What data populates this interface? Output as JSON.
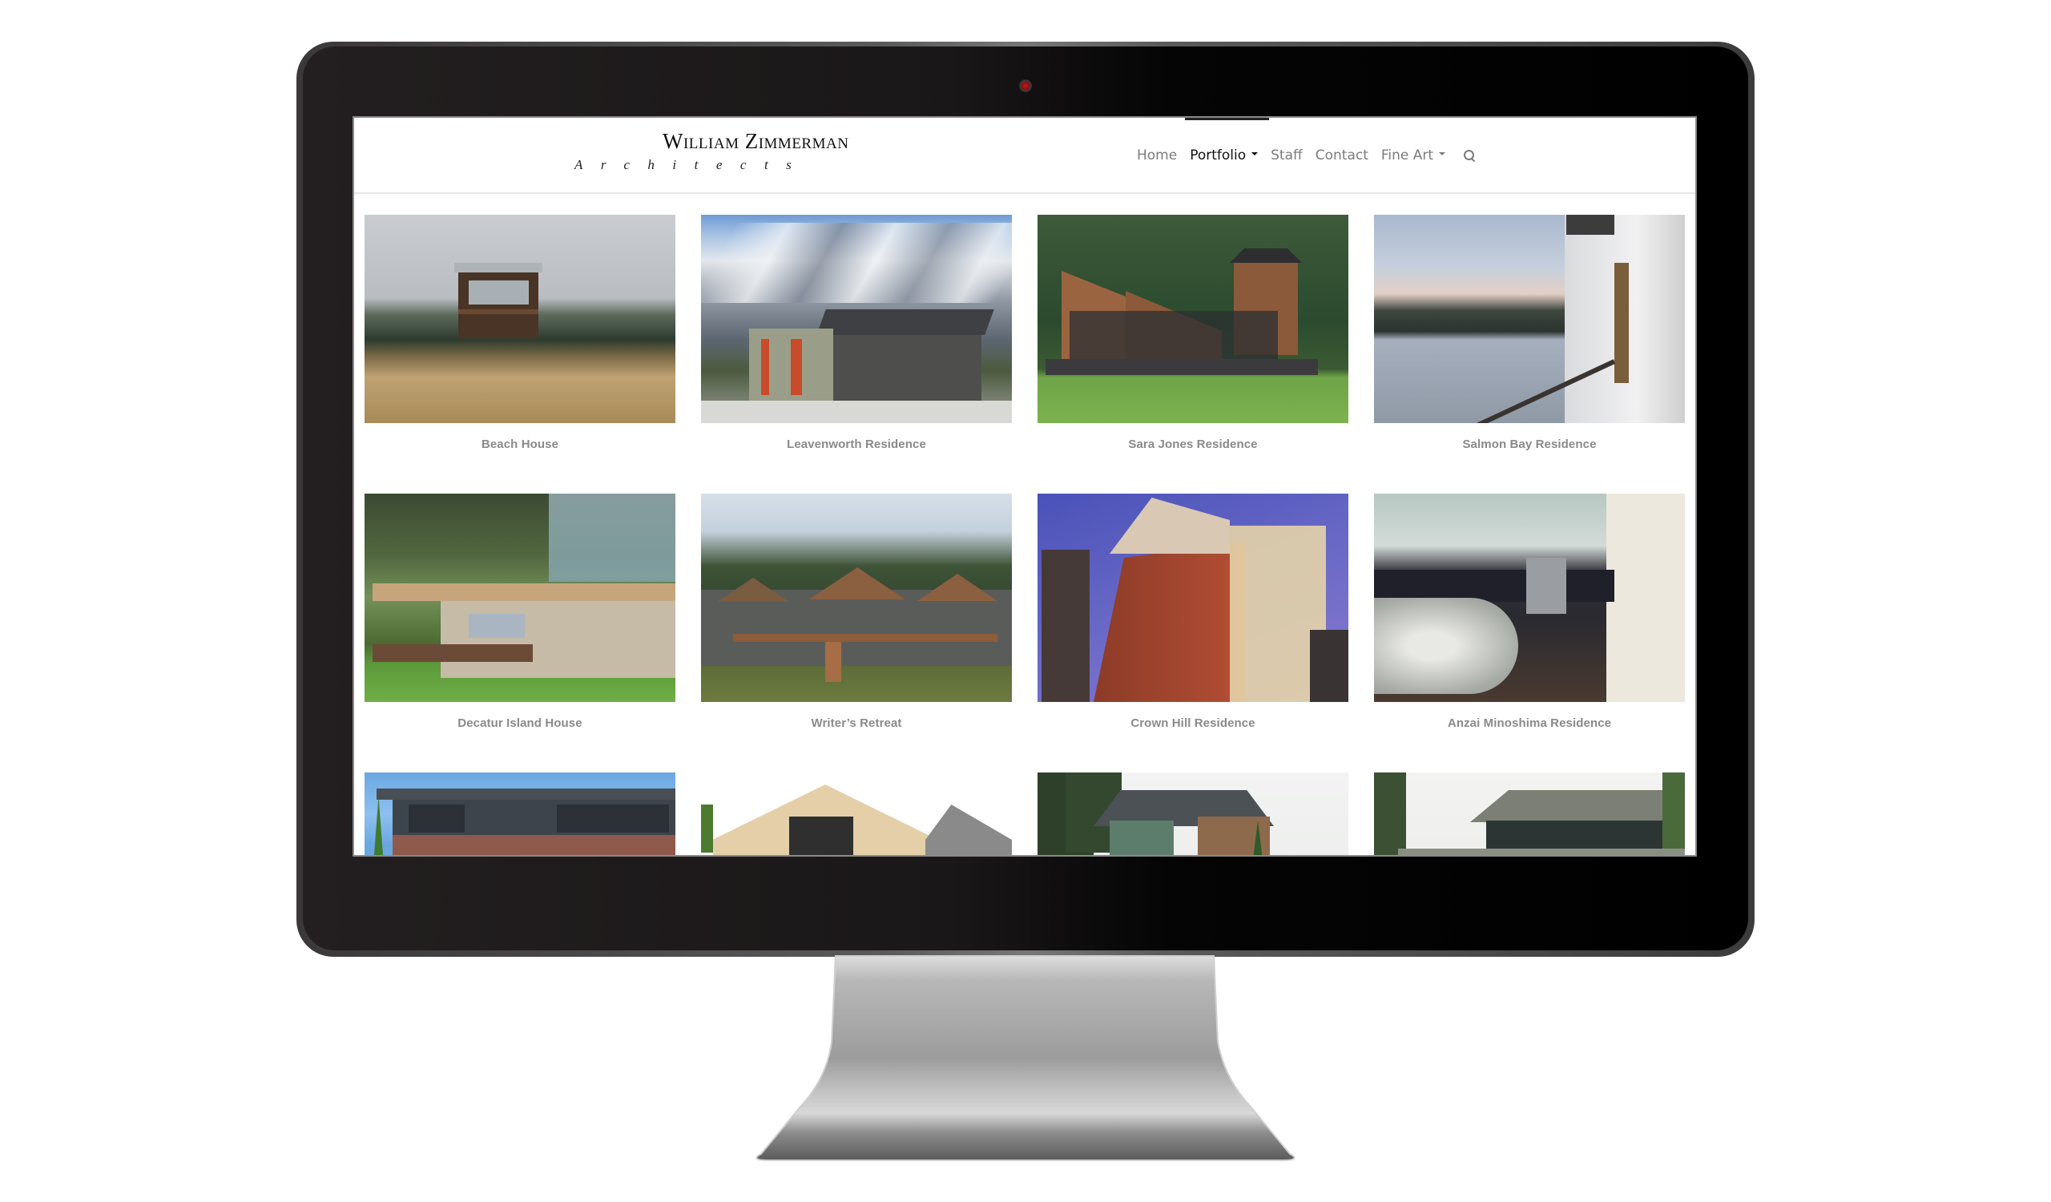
{
  "site": {
    "logo_title": "William Zimmerman",
    "logo_subtitle": "Architects"
  },
  "nav": {
    "items": [
      {
        "label": "Home",
        "active": false,
        "dropdown": false
      },
      {
        "label": "Portfolio",
        "active": true,
        "dropdown": true
      },
      {
        "label": "Staff",
        "active": false,
        "dropdown": false
      },
      {
        "label": "Contact",
        "active": false,
        "dropdown": false
      },
      {
        "label": "Fine Art",
        "active": false,
        "dropdown": true
      }
    ],
    "search_icon": "search-icon"
  },
  "portfolio": {
    "projects": [
      {
        "title": "Beach House",
        "image": "beach-house-photo"
      },
      {
        "title": "Leavenworth Residence",
        "image": "leavenworth-residence-photo"
      },
      {
        "title": "Sara Jones Residence",
        "image": "sara-jones-residence-photo"
      },
      {
        "title": "Salmon Bay Residence",
        "image": "salmon-bay-residence-photo"
      },
      {
        "title": "Decatur Island House",
        "image": "decatur-island-house-photo"
      },
      {
        "title": "Writer’s Retreat",
        "image": "writers-retreat-photo"
      },
      {
        "title": "Crown Hill Residence",
        "image": "crown-hill-residence-photo"
      },
      {
        "title": "Anzai Minoshima Residence",
        "image": "anzai-minoshima-residence-photo"
      },
      {
        "title": "",
        "image": "brick-prairie-house-photo"
      },
      {
        "title": "",
        "image": "gable-house-photo"
      },
      {
        "title": "",
        "image": "green-craftsman-house-photo"
      },
      {
        "title": "",
        "image": "bungalow-house-photo"
      }
    ]
  },
  "device": {
    "camera": "webcam-indicator"
  },
  "colors": {
    "bezel": "#231f20",
    "nav_text": "#7b7b7b",
    "nav_active": "#111111",
    "caption": "#8a8a8a",
    "stand": "#a8a8a8"
  }
}
